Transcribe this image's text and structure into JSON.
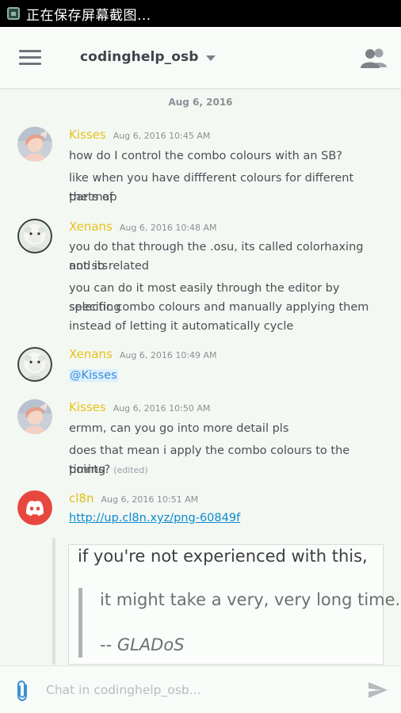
{
  "statusbar": {
    "text": "正在保存屏幕截图..."
  },
  "header": {
    "channel": "codinghelp_osb"
  },
  "date_divider": "Aug 6, 2016",
  "messages": [
    {
      "author": "Kisses",
      "time": "Aug 6, 2016 10:45 AM",
      "lines": [
        "how do I control the combo colours with an SB?",
        "like when you have diffferent colours for different parts of",
        "the map"
      ]
    },
    {
      "author": "Xenans",
      "time": "Aug 6, 2016 10:48 AM",
      "lines": [
        "you do that through the .osu, its called colorhaxing and its",
        "not sb related",
        "you can do it most easily through the editor by selecting",
        "specific combo colours and manually applying them",
        "instead of letting it automatically cycle"
      ]
    },
    {
      "author": "Xenans",
      "time": "Aug 6, 2016 10:49 AM",
      "lines": [
        "@Kisses"
      ]
    },
    {
      "author": "Kisses",
      "time": "Aug 6, 2016 10:50 AM",
      "lines": [
        "ermm, can you go into more detail pls",
        "does that mean i apply the combo colours to the timing",
        "points?"
      ],
      "edited": "(edited)"
    },
    {
      "author": "cl8n",
      "time": "Aug 6, 2016 10:51 AM",
      "link": "http://up.cl8n.xyz/png-60849f"
    }
  ],
  "embed": {
    "line1": "if you're not experienced with this,",
    "line2": "it might take a very, very long time.",
    "line3_prefix": "-- ",
    "line3_name": "GLADoS"
  },
  "composer": {
    "placeholder": "Chat in codinghelp_osb..."
  },
  "colors": {
    "author": "#e8c219",
    "link": "#0a8ad0",
    "discord": "#e8473f",
    "mention_bg": "#dcefff"
  }
}
